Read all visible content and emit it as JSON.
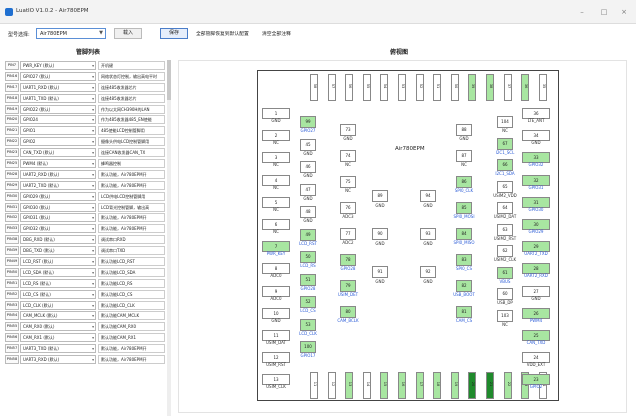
{
  "window": {
    "title": "LuatIO V1.0.2 - Air780EPM",
    "minimize": "–",
    "maximize": "□",
    "close": "×"
  },
  "toolbar": {
    "model_label": "型号选择:",
    "model_value": "Air780EPM",
    "import_label": "载入",
    "save_label": "保存",
    "reset_label": "全部管脚恢复到默认配置",
    "clear_label": "清空全部注释"
  },
  "sections": {
    "pin_list": "管脚列表",
    "view": "俯视图"
  },
  "pins": [
    {
      "name": "PIN7",
      "func": "PWR_KEY (默认)",
      "desc": "开机键"
    },
    {
      "name": "PIN16",
      "func": "GPIO27 (默认)",
      "desc": "网络状态灯控制，输出高电平时"
    },
    {
      "name": "PIN17",
      "func": "UART1_RXD (默认)",
      "desc": "连接485收发器芯片"
    },
    {
      "name": "PIN18",
      "func": "UART1_TXD (默认)",
      "desc": "连接485收发器芯片"
    },
    {
      "name": "PIN19",
      "func": "GPIO22 (默认)",
      "desc": "作为以太网CH390H的LAN"
    },
    {
      "name": "PIN20",
      "func": "GPIO24",
      "desc": "作为485收发器485_EN使能"
    },
    {
      "name": "PIN21",
      "func": "GPIO1",
      "desc": "485使能LCD控制管脚用"
    },
    {
      "name": "PIN22",
      "func": "GPIO2",
      "desc": "摄像头供电LCD控制管脚用"
    },
    {
      "name": "PIN23",
      "func": "CAN_TXD (默认)",
      "desc": "连接CAN收发器CAN_TX"
    },
    {
      "name": "PIN25",
      "func": "PWM4 (默认)",
      "desc": "蜂鸣器控制"
    },
    {
      "name": "PIN28",
      "func": "UART2_RXD (默认)",
      "desc": "默认功能，Air780EPM开"
    },
    {
      "name": "PIN29",
      "func": "UART2_TXD (默认)",
      "desc": "默认功能，Air780EPM开"
    },
    {
      "name": "PIN30",
      "func": "GPIO29 (默认)",
      "desc": "LCD供电LCD控制管脚用"
    },
    {
      "name": "PIN31",
      "func": "GPIO30 (默认)",
      "desc": "LCD背光控制管脚，输出高"
    },
    {
      "name": "PIN32",
      "func": "GPIO31 (默认)",
      "desc": "默认功能，Air780EPM开"
    },
    {
      "name": "PIN33",
      "func": "GPIO32 (默认)",
      "desc": "默认功能，Air780EPM开"
    },
    {
      "name": "PIN38",
      "func": "DBG_RXD (默认)",
      "desc": "调试串口RXD"
    },
    {
      "name": "PIN39",
      "func": "DBG_TXD (默认)",
      "desc": "调试串口TXD"
    },
    {
      "name": "PIN49",
      "func": "LCD_RST (默认)",
      "desc": "默认功能LCD_RST"
    },
    {
      "name": "PIN50",
      "func": "LCD_SDA (默认)",
      "desc": "默认功能LCD_SDA"
    },
    {
      "name": "PIN51",
      "func": "LCD_RS (默认)",
      "desc": "默认功能LCD_RS"
    },
    {
      "name": "PIN52",
      "func": "LCD_CS (默认)",
      "desc": "默认功能LCD_CS"
    },
    {
      "name": "PIN53",
      "func": "LCD_CLK (默认)",
      "desc": "默认功能LCD_CLK"
    },
    {
      "name": "PIN54",
      "func": "CAM_MCLK (默认)",
      "desc": "默认功能CAM_MCLK"
    },
    {
      "name": "PIN55",
      "func": "CAM_RX0 (默认)",
      "desc": "默认功能CAM_RX0"
    },
    {
      "name": "PIN56",
      "func": "CAM_RX1 (默认)",
      "desc": "默认功能CAM_RX1"
    },
    {
      "name": "PIN57",
      "func": "UART3_TXD (默认)",
      "desc": "默认功能，Air780EPM开"
    },
    {
      "name": "PIN58",
      "func": "UART3_RXD (默认)",
      "desc": "默认功能，Air780EPM开"
    }
  ],
  "chip": {
    "label": "Air780EPM",
    "top": [
      {
        "n": "58",
        "c": "w"
      },
      {
        "n": "57",
        "c": "w"
      },
      {
        "n": "56",
        "c": "w"
      },
      {
        "n": "55",
        "c": "w"
      },
      {
        "n": "54",
        "c": "w"
      },
      {
        "n": "53",
        "c": "w"
      },
      {
        "n": "52",
        "c": "w"
      },
      {
        "n": "51",
        "c": "w"
      },
      {
        "n": "50",
        "c": "w"
      },
      {
        "n": "39",
        "c": "g"
      },
      {
        "n": "38",
        "c": "g"
      },
      {
        "n": "37",
        "c": "w"
      },
      {
        "n": "36",
        "c": "g"
      },
      {
        "n": "35",
        "c": "w"
      }
    ],
    "top_sig": [
      "UART3_RXD",
      "UART3_TXD",
      "CAM_RX1",
      "CAM_RX0",
      "CAM_MCLK",
      "LCD_CLK",
      "LCD_CS",
      "LCD_RS",
      "LCD_SDA",
      "DBG_TXD",
      "DBG_RXD",
      "",
      "",
      ""
    ],
    "bottom": [
      {
        "n": "11",
        "c": "w"
      },
      {
        "n": "12",
        "c": "w"
      },
      {
        "n": "13",
        "c": "g"
      },
      {
        "n": "14",
        "c": "w"
      },
      {
        "n": "15",
        "c": "g"
      },
      {
        "n": "16",
        "c": "g"
      },
      {
        "n": "17",
        "c": "g"
      },
      {
        "n": "18",
        "c": "g"
      },
      {
        "n": "19",
        "c": "g"
      },
      {
        "n": "20",
        "c": "dg"
      },
      {
        "n": "21",
        "c": "dg"
      },
      {
        "n": "22",
        "c": "g"
      },
      {
        "n": "23",
        "c": "g"
      },
      {
        "n": "24",
        "c": "w"
      }
    ],
    "bottom_sig": [
      "",
      "",
      "USB_DM",
      "",
      "UART1_RXD",
      "UART1_TXD",
      "",
      "GPIO22",
      "GPIO24",
      "",
      "",
      "CAN_TXD",
      "GPIO27",
      ""
    ],
    "left": [
      {
        "n": "1",
        "t": "GND",
        "c": "w"
      },
      {
        "n": "2",
        "t": "NC",
        "c": "w"
      },
      {
        "n": "3",
        "t": "NC",
        "c": "w"
      },
      {
        "n": "4",
        "t": "NC",
        "c": "w"
      },
      {
        "n": "5",
        "t": "NC",
        "c": "w"
      },
      {
        "n": "6",
        "t": "NC",
        "c": "w"
      },
      {
        "n": "7",
        "t": "PWR_KEY",
        "c": "g"
      },
      {
        "n": "8",
        "t": "ADC0",
        "c": "w"
      },
      {
        "n": "9",
        "t": "ADC0",
        "c": "w"
      },
      {
        "n": "10",
        "t": "GND",
        "c": "w"
      },
      {
        "n": "11",
        "t": "USIM_DAT",
        "c": "w"
      },
      {
        "n": "12",
        "t": "USIM_RST",
        "c": "w"
      },
      {
        "n": "13",
        "t": "USIM_CLK",
        "c": "w"
      }
    ],
    "right": [
      {
        "n": "36",
        "t": "LTE_ANT",
        "c": "w"
      },
      {
        "n": "34",
        "t": "GND",
        "c": "w"
      },
      {
        "n": "33",
        "t": "GPIO32",
        "c": "g"
      },
      {
        "n": "32",
        "t": "GPIO31",
        "c": "g"
      },
      {
        "n": "31",
        "t": "GPIO30",
        "c": "g"
      },
      {
        "n": "30",
        "t": "GPIO29",
        "c": "g"
      },
      {
        "n": "29",
        "t": "UART2_TXD",
        "c": "g"
      },
      {
        "n": "28",
        "t": "UART2_RXD",
        "c": "g"
      },
      {
        "n": "27",
        "t": "GND",
        "c": "w"
      },
      {
        "n": "26",
        "t": "PWM4",
        "c": "g"
      },
      {
        "n": "25",
        "t": "CAN_TXD",
        "c": "g"
      },
      {
        "n": "24",
        "t": "VDD_EXT",
        "c": "w"
      },
      {
        "n": "23",
        "t": "GPIO2",
        "c": "g"
      }
    ],
    "mid": [
      {
        "n": "99",
        "t": "GPIO27",
        "c": "g"
      },
      {
        "n": "45",
        "t": "GND",
        "c": "w"
      },
      {
        "n": "46",
        "t": "GND",
        "c": "w"
      },
      {
        "n": "47",
        "t": "GND",
        "c": "w"
      },
      {
        "n": "48",
        "t": "GND",
        "c": "w"
      },
      {
        "n": "49",
        "t": "LCD_RST",
        "c": "g"
      },
      {
        "n": "50",
        "t": "LCD_RS",
        "c": "g"
      },
      {
        "n": "51",
        "t": "GPIO28",
        "c": "g"
      },
      {
        "n": "52",
        "t": "LCD_CS",
        "c": "g"
      },
      {
        "n": "53",
        "t": "LCD_CLK",
        "c": "g"
      },
      {
        "n": "100",
        "t": "GPIO17",
        "c": "g"
      },
      {
        "n": "73",
        "t": "GND",
        "c": "w"
      },
      {
        "n": "74",
        "t": "NC",
        "c": "w"
      },
      {
        "n": "75",
        "t": "NC",
        "c": "w"
      },
      {
        "n": "76",
        "t": "ADC3",
        "c": "w"
      },
      {
        "n": "77",
        "t": "ADC2",
        "c": "w"
      },
      {
        "n": "78",
        "t": "GPIO28",
        "c": "g"
      },
      {
        "n": "79",
        "t": "USIM_DET",
        "c": "g"
      },
      {
        "n": "80",
        "t": "CAM_BCLK",
        "c": "g"
      },
      {
        "n": "89",
        "t": "GND",
        "c": "w"
      },
      {
        "n": "90",
        "t": "GND",
        "c": "w"
      },
      {
        "n": "91",
        "t": "GND",
        "c": "w"
      },
      {
        "n": "94",
        "t": "GND",
        "c": "w"
      },
      {
        "n": "93",
        "t": "GND",
        "c": "w"
      },
      {
        "n": "92",
        "t": "GND",
        "c": "w"
      },
      {
        "n": "88",
        "t": "GND",
        "c": "w"
      },
      {
        "n": "87",
        "t": "NC",
        "c": "w"
      },
      {
        "n": "86",
        "t": "SPI0_CLK",
        "c": "g"
      },
      {
        "n": "85",
        "t": "SPI0_MOSI",
        "c": "g"
      },
      {
        "n": "84",
        "t": "SPI0_MISO",
        "c": "g"
      },
      {
        "n": "83",
        "t": "SPI0_CS",
        "c": "g"
      },
      {
        "n": "82",
        "t": "USB_BOOT",
        "c": "g"
      },
      {
        "n": "81",
        "t": "CAM_CS",
        "c": "g"
      },
      {
        "n": "104",
        "t": "NC",
        "c": "w"
      },
      {
        "n": "67",
        "t": "I2C1_SCL",
        "c": "g"
      },
      {
        "n": "66",
        "t": "I2C1_SDA",
        "c": "g"
      },
      {
        "n": "65",
        "t": "USIM2_VDD",
        "c": "w"
      },
      {
        "n": "64",
        "t": "USIM2_DAT",
        "c": "w"
      },
      {
        "n": "63",
        "t": "USIM2_RST",
        "c": "w"
      },
      {
        "n": "62",
        "t": "USIM2_CLK",
        "c": "w"
      },
      {
        "n": "61",
        "t": "VBUS",
        "c": "g"
      },
      {
        "n": "60",
        "t": "USB_DP",
        "c": "w"
      },
      {
        "n": "103",
        "t": "NC",
        "c": "w"
      }
    ]
  }
}
